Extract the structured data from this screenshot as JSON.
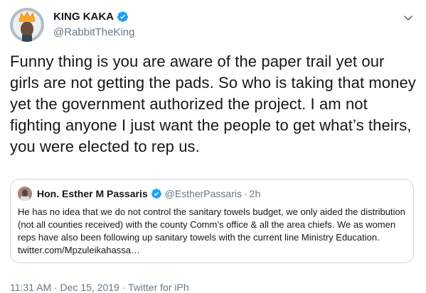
{
  "tweet": {
    "display_name": "KING KAKA",
    "handle": "@RabbitTheKing",
    "text": "Funny thing is you are aware of the paper trail yet our girls are not getting the pads. So who is taking that money yet the government authorized the project. I am not fighting anyone I just want the people to get what’s theirs, you were elected to rep us.",
    "timestamp_partial": "11:31 AM · Dec 15, 2019 · Twitter for iPh"
  },
  "quoted_tweet": {
    "display_name": "Hon. Esther M Passaris",
    "handle": "@EstherPassaris",
    "separator": "·",
    "time": "2h",
    "text": "He has no idea that we do not control the sanitary towels budget, we only aided the distribution (not all counties received) with the county Comm’s office & all the area chiefs. We as women reps have also been following up sanitary towels with the current line Ministry Education.",
    "link_text": "twitter.com/Mpzuleikahassa…"
  },
  "colors": {
    "verified": "#1da1f2",
    "secondary_text": "#657786",
    "border": "#ccd6dd"
  },
  "icons": {
    "verified": "verified-badge-icon",
    "more": "chevron-down-icon"
  }
}
